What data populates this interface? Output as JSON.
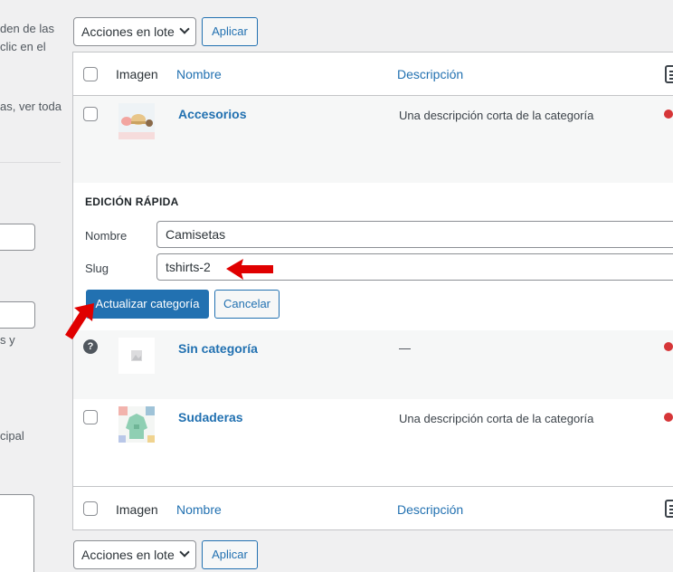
{
  "left_panel": {
    "text_lines": [
      "den de las",
      "clic en el",
      "as, ver toda",
      "s y",
      "cipal"
    ]
  },
  "bulk_actions": {
    "select_value": "Acciones en lote",
    "apply_label": "Aplicar"
  },
  "table": {
    "columns": {
      "image": "Imagen",
      "name": "Nombre",
      "description": "Descripción"
    },
    "rows": [
      {
        "name": "Accesorios",
        "description": "Una descripción corta de la categoría"
      },
      {
        "name": "Sin categoría",
        "description": "—"
      },
      {
        "name": "Sudaderas",
        "description": "Una descripción corta de la categoría"
      }
    ]
  },
  "quick_edit": {
    "title": "EDICIÓN RÁPIDA",
    "name_label": "Nombre",
    "name_value": "Camisetas",
    "slug_label": "Slug",
    "slug_value": "tshirts-2",
    "update_label": "Actualizar categoría",
    "cancel_label": "Cancelar"
  },
  "colors": {
    "accent": "#2271b1",
    "annotation_arrow": "#e00000",
    "status_dot": "#d63638"
  }
}
